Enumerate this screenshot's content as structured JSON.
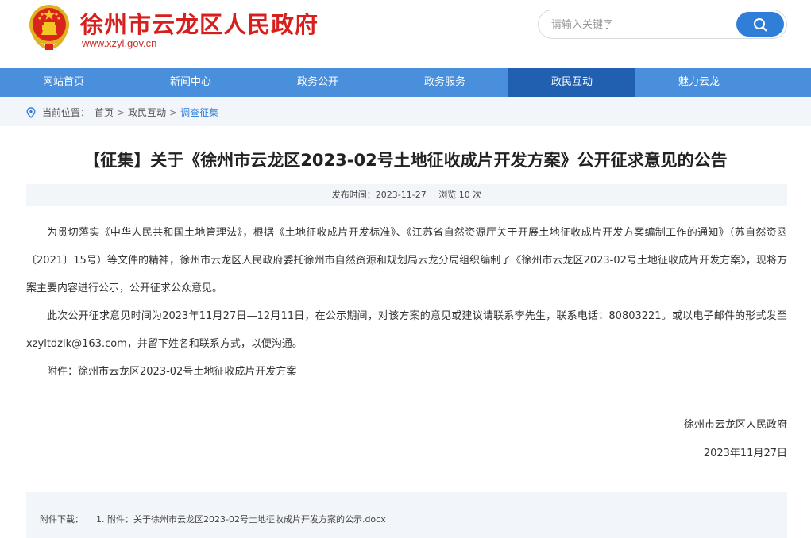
{
  "header": {
    "site_title": "徐州市云龙区人民政府",
    "site_url": "www.xzyl.gov.cn",
    "emblem_icon": "national-emblem-icon"
  },
  "search": {
    "placeholder": "请输入关键字",
    "button_icon": "search-icon"
  },
  "nav": {
    "items": [
      {
        "label": "网站首页"
      },
      {
        "label": "新闻中心"
      },
      {
        "label": "政务公开"
      },
      {
        "label": "政务服务"
      },
      {
        "label": "政民互动",
        "active": true
      },
      {
        "label": "魅力云龙"
      }
    ]
  },
  "breadcrumb": {
    "prefix": "当前位置：",
    "items": [
      "首页",
      "政民互动",
      "调查征集"
    ],
    "separator": ">"
  },
  "article": {
    "title": "【征集】关于《徐州市云龙区2023-02号土地征收成片开发方案》公开征求意见的公告",
    "publish_label": "发布时间：",
    "publish_date": "2023-11-27",
    "views_text": "浏览 10 次",
    "paragraphs": [
      "为贯切落实《中华人民共和国土地管理法》，根据《土地征收成片开发标准》、《江苏省自然资源厅关于开展土地征收成片开发方案编制工作的通知》（苏自然资函〔2021〕15号）等文件的精神，徐州市云龙区人民政府委托徐州市自然资源和规划局云龙分局组织编制了《徐州市云龙区2023-02号土地征收成片开发方案》，现将方案主要内容进行公示，公开征求公众意见。",
      "此次公开征求意见时间为2023年11月27日—12月11日，在公示期间，对该方案的意见或建议请联系李先生，联系电话：80803221。或以电子邮件的形式发至xzyltdzlk@163.com，并留下姓名和联系方式，以便沟通。",
      "附件：徐州市云龙区2023-02号土地征收成片开发方案"
    ],
    "signature": "徐州市云龙区人民政府",
    "sign_date": "2023年11月27日"
  },
  "attachments": {
    "label": "附件下载：",
    "items": [
      "1. 附件：关于徐州市云龙区2023-02号土地征收成片开发方案的公示.docx"
    ]
  },
  "colors": {
    "brand_red": "#d7201e",
    "nav_blue": "#4a8fdb",
    "nav_active": "#2160b0",
    "search_button": "#2f7fd8",
    "bar_bg": "#f2f5f9"
  }
}
